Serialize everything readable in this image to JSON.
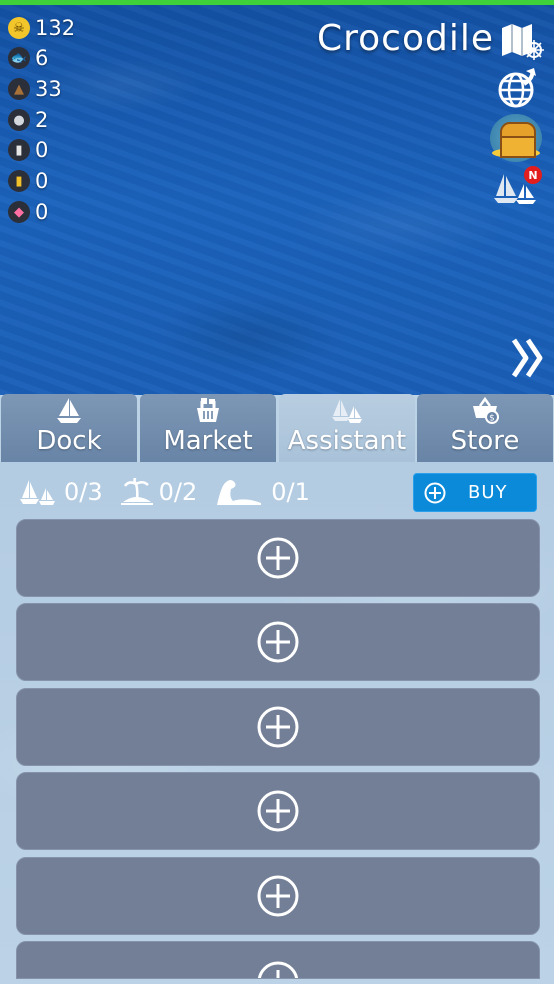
{
  "resources": [
    {
      "icon": "skull-coin-icon",
      "value": "132"
    },
    {
      "icon": "fish-icon",
      "value": "6"
    },
    {
      "icon": "wood-icon",
      "value": "33"
    },
    {
      "icon": "stone-icon",
      "value": "2"
    },
    {
      "icon": "iron-icon",
      "value": "0"
    },
    {
      "icon": "gold-icon",
      "value": "0"
    },
    {
      "icon": "gem-icon",
      "value": "0"
    }
  ],
  "location": "Crocodile",
  "badge": "N",
  "tabs": [
    {
      "label": "Dock",
      "icon": "sailboat-icon"
    },
    {
      "label": "Market",
      "icon": "basket-icon"
    },
    {
      "label": "Assistant",
      "icon": "ships-icon"
    },
    {
      "label": "Store",
      "icon": "cart-dollar-icon"
    }
  ],
  "active_tab": "Assistant",
  "counts": {
    "ships": "0/3",
    "islands": "0/2",
    "monsters": "0/1"
  },
  "buy_label": "BUY",
  "colors": {
    "ocean": "#1a5fb8",
    "slot": "#737f97",
    "buy": "#0a8ad9",
    "topbar": "#3fd13a"
  }
}
